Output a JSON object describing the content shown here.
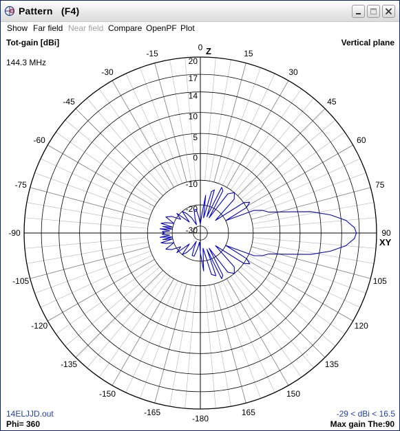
{
  "window": {
    "title": "Pattern   (F4)"
  },
  "menu": {
    "show": "Show",
    "far_field": "Far field",
    "near_field": "Near field",
    "compare": "Compare",
    "openpf": "OpenPF",
    "plot": "Plot"
  },
  "plot": {
    "quantity": "Tot-gain [dBi]",
    "plane": "Vertical plane",
    "frequency": "144.3 MHz",
    "filename": "14ELJJD.out",
    "phi": "Phi= 360",
    "range_text": "-29 < dBi < 16.5",
    "max_gain": "Max gain The:90",
    "z_label": "Z",
    "xy_label": "XY"
  },
  "colors": {
    "trace": "#0000c8",
    "grid_major": "#000000",
    "grid_minor": "#bdbdbd",
    "info_text": "#1f3fb0"
  },
  "chart_data": {
    "type": "polar",
    "quantity": "Tot-gain [dBi]",
    "plane": "Vertical plane",
    "radial_ticks": [
      20,
      17,
      14,
      10,
      5,
      0,
      -10,
      -20,
      -30
    ],
    "angle_ticks": [
      0,
      15,
      30,
      45,
      60,
      75,
      90,
      105,
      120,
      135,
      150,
      165,
      -180,
      -165,
      -150,
      -135,
      -120,
      -105,
      -90,
      -75,
      -60,
      -45,
      -30,
      -15
    ],
    "theta_unit": "deg",
    "pattern": {
      "theta": [
        0,
        5,
        8,
        12,
        15,
        18,
        22,
        25,
        28,
        30,
        35,
        40,
        45,
        50,
        55,
        58,
        61,
        64,
        67,
        70,
        73,
        76,
        79,
        82,
        85,
        88,
        90,
        92,
        95,
        98,
        101,
        104,
        107,
        110,
        113,
        116,
        119,
        122,
        125,
        130,
        135,
        140,
        145,
        150,
        152,
        155,
        158,
        160,
        165,
        170,
        175,
        180,
        185,
        190,
        195,
        200,
        203,
        206,
        210,
        215,
        220,
        225,
        230,
        235,
        240,
        245,
        250,
        253,
        256,
        258,
        260,
        262,
        264,
        266,
        268,
        270,
        272,
        274,
        276,
        278,
        280,
        282,
        284,
        287,
        290,
        295,
        300,
        305,
        310,
        315,
        320,
        325,
        330,
        335,
        340,
        345,
        350,
        355,
        360
      ],
      "gain_dbi": [
        -29,
        -24,
        -16,
        -26,
        -14,
        -13,
        -25,
        -11,
        -12,
        -25,
        -12,
        -10,
        -12,
        -24,
        -10,
        -8,
        -10,
        -20,
        -8,
        -5,
        -3,
        2,
        8,
        12,
        14.8,
        16.2,
        16.5,
        16.2,
        14.8,
        12,
        8,
        2,
        -3,
        -5,
        -8,
        -20,
        -10,
        -8,
        -10,
        -24,
        -12,
        -10,
        -12,
        -25,
        -12,
        -11,
        -25,
        -13,
        -14,
        -26,
        -16,
        -24,
        -29,
        -26,
        -22,
        -22,
        -26,
        -29,
        -25,
        -22,
        -20,
        -26,
        -19,
        -22,
        -18,
        -16,
        -20,
        -17,
        -15,
        -20,
        -16,
        -20,
        -15,
        -19,
        -16,
        -17,
        -16,
        -19,
        -15,
        -20,
        -16,
        -20,
        -15,
        -17,
        -20,
        -16,
        -18,
        -22,
        -19,
        -26,
        -20,
        -22,
        -25,
        -29,
        -26,
        -22,
        -22,
        -26,
        -29
      ]
    }
  }
}
